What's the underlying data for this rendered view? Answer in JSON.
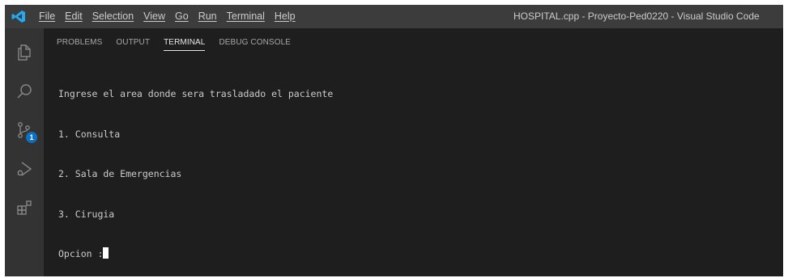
{
  "titlebar": {
    "menu": [
      "File",
      "Edit",
      "Selection",
      "View",
      "Go",
      "Run",
      "Terminal",
      "Help"
    ],
    "window_title": "HOSPITAL.cpp - Proyecto-Ped0220 - Visual Studio Code",
    "logo_color": "#23a9f2"
  },
  "activitybar": {
    "icons": [
      "explorer-icon",
      "search-icon",
      "source-control-icon",
      "run-debug-icon",
      "extensions-icon"
    ],
    "source_control_badge": "1",
    "badge_color": "#0e70c0"
  },
  "panel": {
    "tabs": [
      {
        "label": "PROBLEMS",
        "active": false
      },
      {
        "label": "OUTPUT",
        "active": false
      },
      {
        "label": "TERMINAL",
        "active": true
      },
      {
        "label": "DEBUG CONSOLE",
        "active": false
      }
    ]
  },
  "terminal": {
    "lines": [
      "Ingrese el area donde sera trasladado el paciente",
      "1. Consulta",
      "2. Sala de Emergencias",
      "3. Cirugia"
    ],
    "prompt": "Opcion :"
  }
}
